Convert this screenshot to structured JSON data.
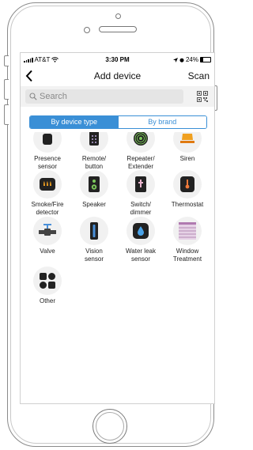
{
  "status_bar": {
    "carrier": "AT&T",
    "time": "3:30 PM",
    "battery": "24%"
  },
  "nav": {
    "back_icon": "chevron-left-icon",
    "title": "Add device",
    "scan_label": "Scan"
  },
  "search": {
    "placeholder": "Search",
    "icon": "search-icon",
    "qr_icon": "qr-code-icon"
  },
  "segments": {
    "by_device_type": "By device type",
    "by_brand": "By brand",
    "selected": "By device type"
  },
  "colors": {
    "accent": "#3a8fd6",
    "icon_circle": "#f1f1f1"
  },
  "devices": [
    {
      "label": "Presence\nsensor",
      "icon": "presence-sensor-icon"
    },
    {
      "label": "Remote/\nbutton",
      "icon": "remote-icon"
    },
    {
      "label": "Repeater/\nExtender",
      "icon": "repeater-icon"
    },
    {
      "label": "Siren",
      "icon": "siren-icon"
    },
    {
      "label": "Smoke/Fire\ndetector",
      "icon": "smoke-detector-icon"
    },
    {
      "label": "Speaker",
      "icon": "speaker-icon"
    },
    {
      "label": "Switch/\ndimmer",
      "icon": "switch-icon"
    },
    {
      "label": "Thermostat",
      "icon": "thermostat-icon"
    },
    {
      "label": "Valve",
      "icon": "valve-icon"
    },
    {
      "label": "Vision\nsensor",
      "icon": "vision-sensor-icon"
    },
    {
      "label": "Water leak\nsensor",
      "icon": "water-leak-icon"
    },
    {
      "label": "Window\nTreatment",
      "icon": "window-treatment-icon"
    },
    {
      "label": "Other",
      "icon": "other-grid-icon"
    }
  ]
}
